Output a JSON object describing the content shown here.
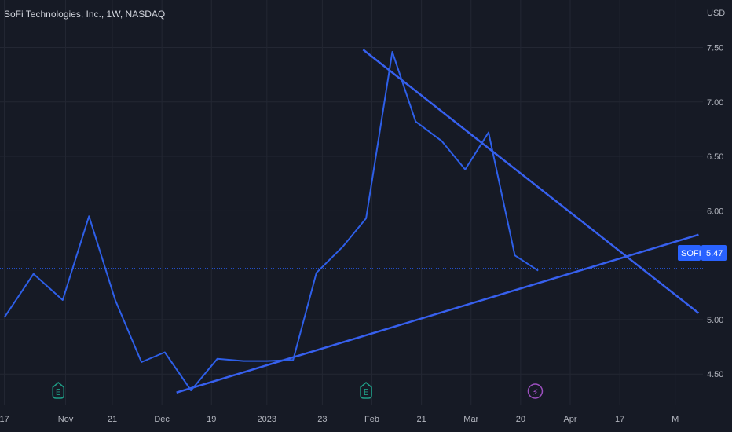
{
  "header": {
    "title": "SoFi Technologies, Inc., 1W, NASDAQ"
  },
  "price_axis": {
    "currency": "USD"
  },
  "last_price": {
    "symbol": "SOFI",
    "value": "5.47"
  },
  "colors": {
    "background": "#161a25",
    "line": "#2e5fe8",
    "trend": "#3760ee",
    "badge": "#2962ff",
    "earnings": "#1f9e87",
    "dividend": "#9c4fbf",
    "grid": "#232733",
    "axis_text": "#b2b5be"
  },
  "chart_data": {
    "type": "line",
    "title": "SoFi Technologies, Inc., 1W, NASDAQ",
    "ylabel": "USD",
    "ylim": [
      4.22,
      7.72
    ],
    "yticks": [
      4.5,
      5.0,
      6.0,
      6.5,
      7.0,
      7.5
    ],
    "grid": true,
    "x_tick_labels": [
      "17",
      "Nov",
      "21",
      "Dec",
      "19",
      "2023",
      "23",
      "Feb",
      "21",
      "Mar",
      "20",
      "Apr",
      "17",
      "M"
    ],
    "x_tick_positions": [
      0,
      2.1,
      3.7,
      5.4,
      7.1,
      9.0,
      10.9,
      12.6,
      14.3,
      16.0,
      17.7,
      19.4,
      21.1,
      23.0
    ],
    "xlim": [
      -0.15,
      23.95
    ],
    "series": [
      {
        "x": [
          0,
          1,
          2,
          2.9,
          3.8,
          4.7,
          5.5,
          6.4,
          7.3,
          8.2,
          9.0,
          9.9,
          10.7,
          11.6,
          12.4,
          13.3,
          14.1,
          15.0,
          15.8,
          16.6,
          17.5,
          18.3
        ],
        "values": [
          5.02,
          5.42,
          5.18,
          5.95,
          5.18,
          4.61,
          4.7,
          4.35,
          4.64,
          4.62,
          4.62,
          4.63,
          5.43,
          5.67,
          5.93,
          7.46,
          6.82,
          6.64,
          6.38,
          6.72,
          5.59,
          5.45
        ]
      }
    ],
    "trendlines": [
      {
        "name": "upper",
        "x": [
          12.3,
          23.8
        ],
        "values": [
          7.48,
          5.06
        ]
      },
      {
        "name": "lower",
        "x": [
          5.9,
          23.8
        ],
        "values": [
          4.33,
          5.78
        ]
      }
    ],
    "last_value": 5.47,
    "event_markers": [
      {
        "type": "earnings",
        "label": "E",
        "x": 1.85
      },
      {
        "type": "earnings",
        "label": "E",
        "x": 12.4
      },
      {
        "type": "dividend",
        "label": "⚡",
        "x": 18.2
      }
    ]
  }
}
